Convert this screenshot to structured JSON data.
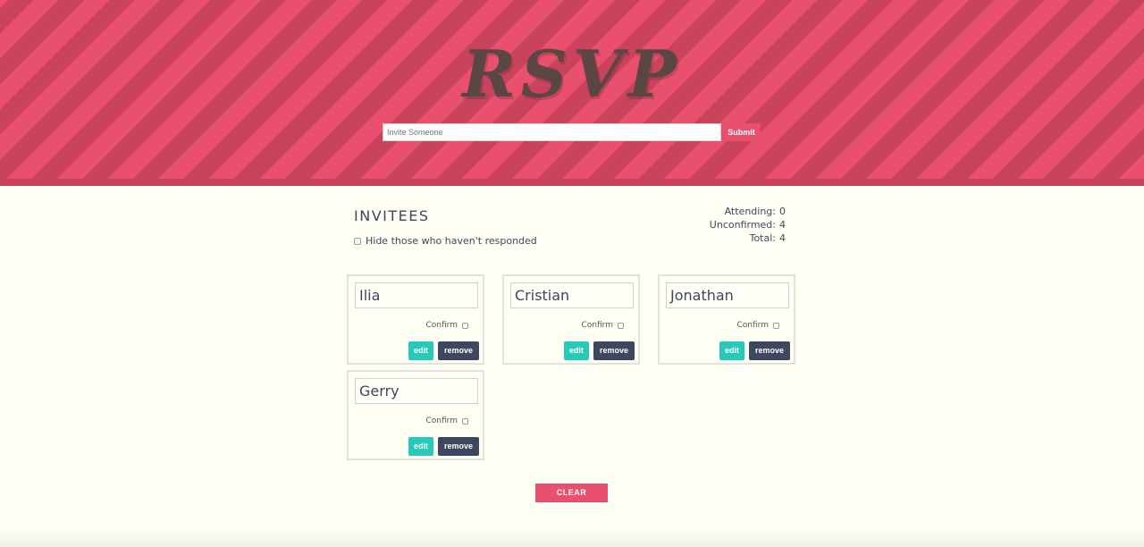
{
  "header": {
    "logo_text": "RSVP",
    "invite_placeholder": "Invite Someone",
    "invite_value": "",
    "submit_label": "Submit"
  },
  "invitees": {
    "title": "INVITEES",
    "hide_label": "Hide those who haven't responded",
    "hide_checked": false
  },
  "counts": {
    "attending_label": "Attending:",
    "attending_value": "0",
    "unconfirmed_label": "Unconfirmed:",
    "unconfirmed_value": "4",
    "total_label": "Total:",
    "total_value": "4"
  },
  "cards": [
    {
      "name": "Ilia",
      "confirm_label": "Confirm",
      "confirmed": false,
      "edit_label": "edit",
      "remove_label": "remove"
    },
    {
      "name": "Cristian",
      "confirm_label": "Confirm",
      "confirmed": false,
      "edit_label": "edit",
      "remove_label": "remove"
    },
    {
      "name": "Jonathan",
      "confirm_label": "Confirm",
      "confirmed": false,
      "edit_label": "edit",
      "remove_label": "remove"
    },
    {
      "name": "Gerry",
      "confirm_label": "Confirm",
      "confirmed": false,
      "edit_label": "edit",
      "remove_label": "remove"
    }
  ],
  "footer": {
    "clear_label": "CLEAR"
  },
  "colors": {
    "accent": "#e9506e",
    "stripe_dark": "#c9435d",
    "edit": "#27c9b8",
    "remove": "#3e4760",
    "background": "#fffff4"
  }
}
